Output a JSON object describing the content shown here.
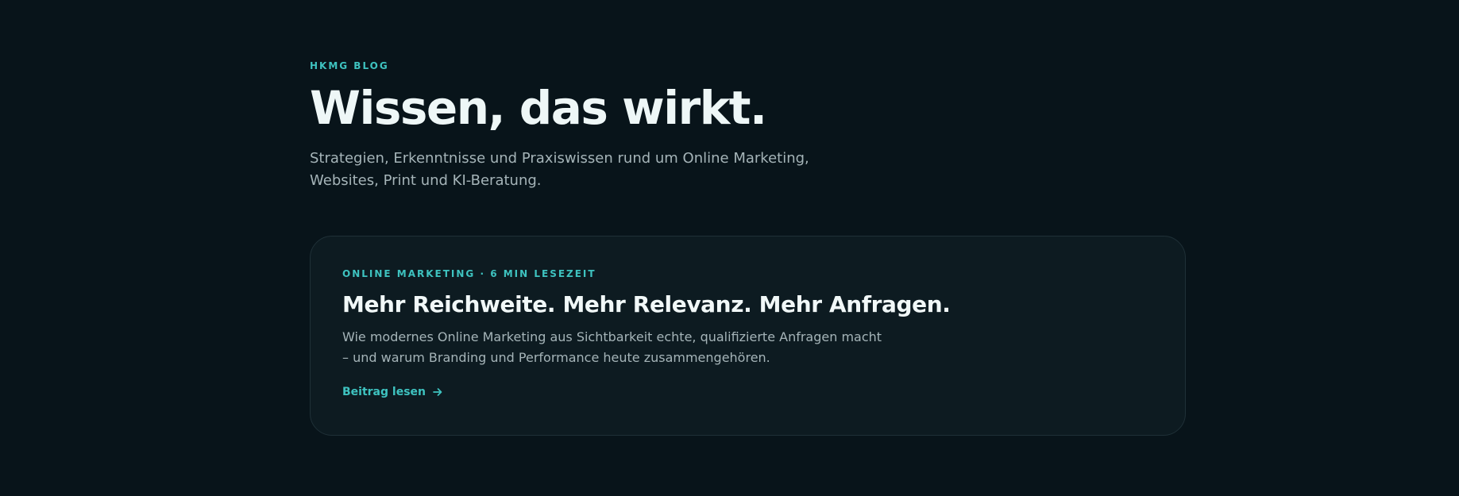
{
  "header": {
    "eyebrow": "HKMG BLOG",
    "title": "Wissen, das wirkt.",
    "subtitle": "Strategien, Erkenntnisse und Praxiswissen rund um Online Marketing, Websites, Print und KI-Beratung."
  },
  "featured_post": {
    "meta": "ONLINE MARKETING · 6 MIN LESEZEIT",
    "title": "Mehr Reichweite. Mehr Relevanz. Mehr Anfragen.",
    "excerpt": "Wie modernes Online Marketing aus Sichtbarkeit echte, qualifizierte Anfragen macht – und warum Branding und Performance heute zusammengehören.",
    "link_label": "Beitrag lesen",
    "link_icon": "arrow-right-icon"
  },
  "colors": {
    "background": "#08141a",
    "card": "#0d1b21",
    "accent": "#3ec3c0",
    "text": "#eef7f7",
    "muted": "#a5b4b8"
  }
}
